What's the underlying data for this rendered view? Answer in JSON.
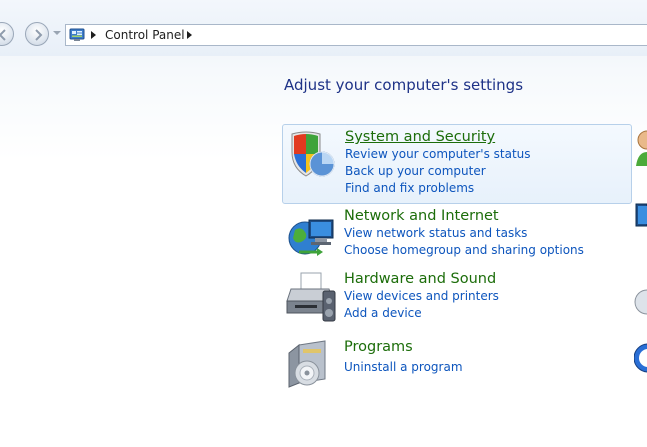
{
  "address_bar": {
    "breadcrumb": "Control Panel"
  },
  "main": {
    "title": "Adjust your computer's settings",
    "categories": [
      {
        "title": "System and Security",
        "icon": "security-shield-icon",
        "links": [
          "Review your computer's status",
          "Back up your computer",
          "Find and fix problems"
        ]
      },
      {
        "title": "Network and Internet",
        "icon": "network-globe-icon",
        "links": [
          "View network status and tasks",
          "Choose homegroup and sharing options"
        ]
      },
      {
        "title": "Hardware and Sound",
        "icon": "printer-icon",
        "links": [
          "View devices and printers",
          "Add a device"
        ]
      },
      {
        "title": "Programs",
        "icon": "programs-box-icon",
        "links": [
          "Uninstall a program"
        ]
      }
    ]
  },
  "colors": {
    "title_blue": "#1e3287",
    "category_green": "#1c6d0a",
    "link_blue": "#0d55bd",
    "highlight_border": "#b7d0ea"
  }
}
